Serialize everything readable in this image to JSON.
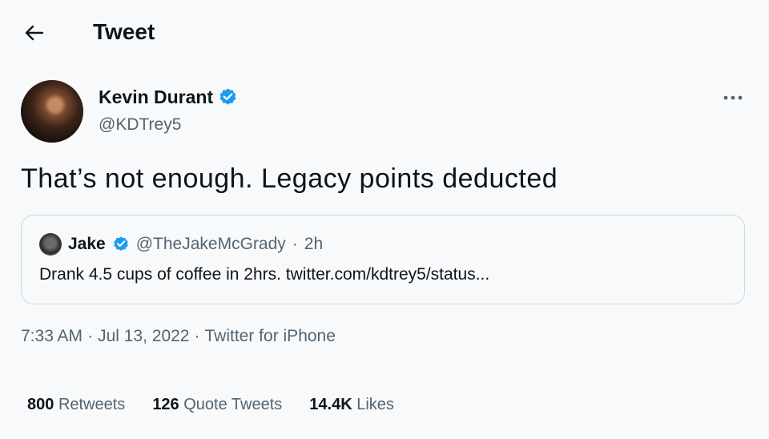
{
  "header": {
    "title": "Tweet"
  },
  "tweet": {
    "author_name": "Kevin Durant",
    "author_handle": "@KDTrey5",
    "text": "That’s not enough. Legacy points deducted",
    "time": "7:33 AM",
    "date": "Jul 13, 2022",
    "source": "Twitter for iPhone",
    "sep1": "·",
    "sep2": "·"
  },
  "quote": {
    "name": "Jake",
    "handle": "@TheJakeMcGrady",
    "sep": "·",
    "age": "2h",
    "text": "Drank 4.5 cups of coffee in 2hrs. twitter.com/kdtrey5/status..."
  },
  "stats": {
    "retweets": {
      "num": "800",
      "label": "Retweets"
    },
    "quote_tweets": {
      "num": "126",
      "label": "Quote Tweets"
    },
    "likes": {
      "num": "14.4K",
      "label": "Likes"
    }
  },
  "icons": {
    "back": "arrow-left-icon",
    "verified": "verified-badge-icon",
    "more": "more-dots-icon"
  },
  "colors": {
    "verified": "#1d9bf0",
    "text_primary": "#0f1419",
    "text_secondary": "#536471"
  }
}
